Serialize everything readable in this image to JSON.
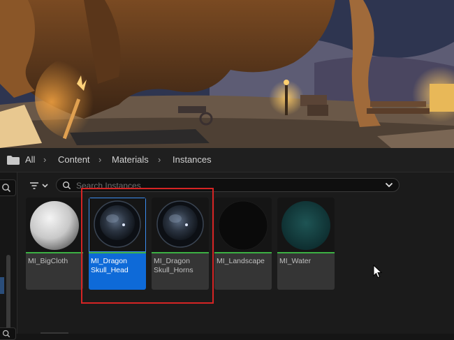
{
  "breadcrumb": {
    "items": [
      "All",
      "Content",
      "Materials",
      "Instances"
    ]
  },
  "search": {
    "placeholder": "Search Instances",
    "value": ""
  },
  "assets": [
    {
      "line1": "MI_BigCloth",
      "line2": "",
      "selected": false,
      "thumb": "white-sphere"
    },
    {
      "line1": "MI_Dragon",
      "line2": "Skull_Head",
      "selected": true,
      "thumb": "dark-glossy-sphere"
    },
    {
      "line1": "MI_Dragon",
      "line2": "Skull_Horns",
      "selected": false,
      "thumb": "dark-glossy-sphere"
    },
    {
      "line1": "MI_Landscape",
      "line2": "",
      "selected": false,
      "thumb": "black-sphere"
    },
    {
      "line1": "MI_Water",
      "line2": "",
      "selected": false,
      "thumb": "teal-sphere"
    }
  ],
  "colors": {
    "selection": "#0e6ad8",
    "asset_type_bar": "#3cb043",
    "highlight": "#d62424"
  },
  "icons": {
    "path_root": "folder-icon",
    "filter": "filter-icon",
    "search": "search-icon",
    "dropdown": "chevron-down-icon",
    "cursor": "mouse-cursor-icon"
  }
}
